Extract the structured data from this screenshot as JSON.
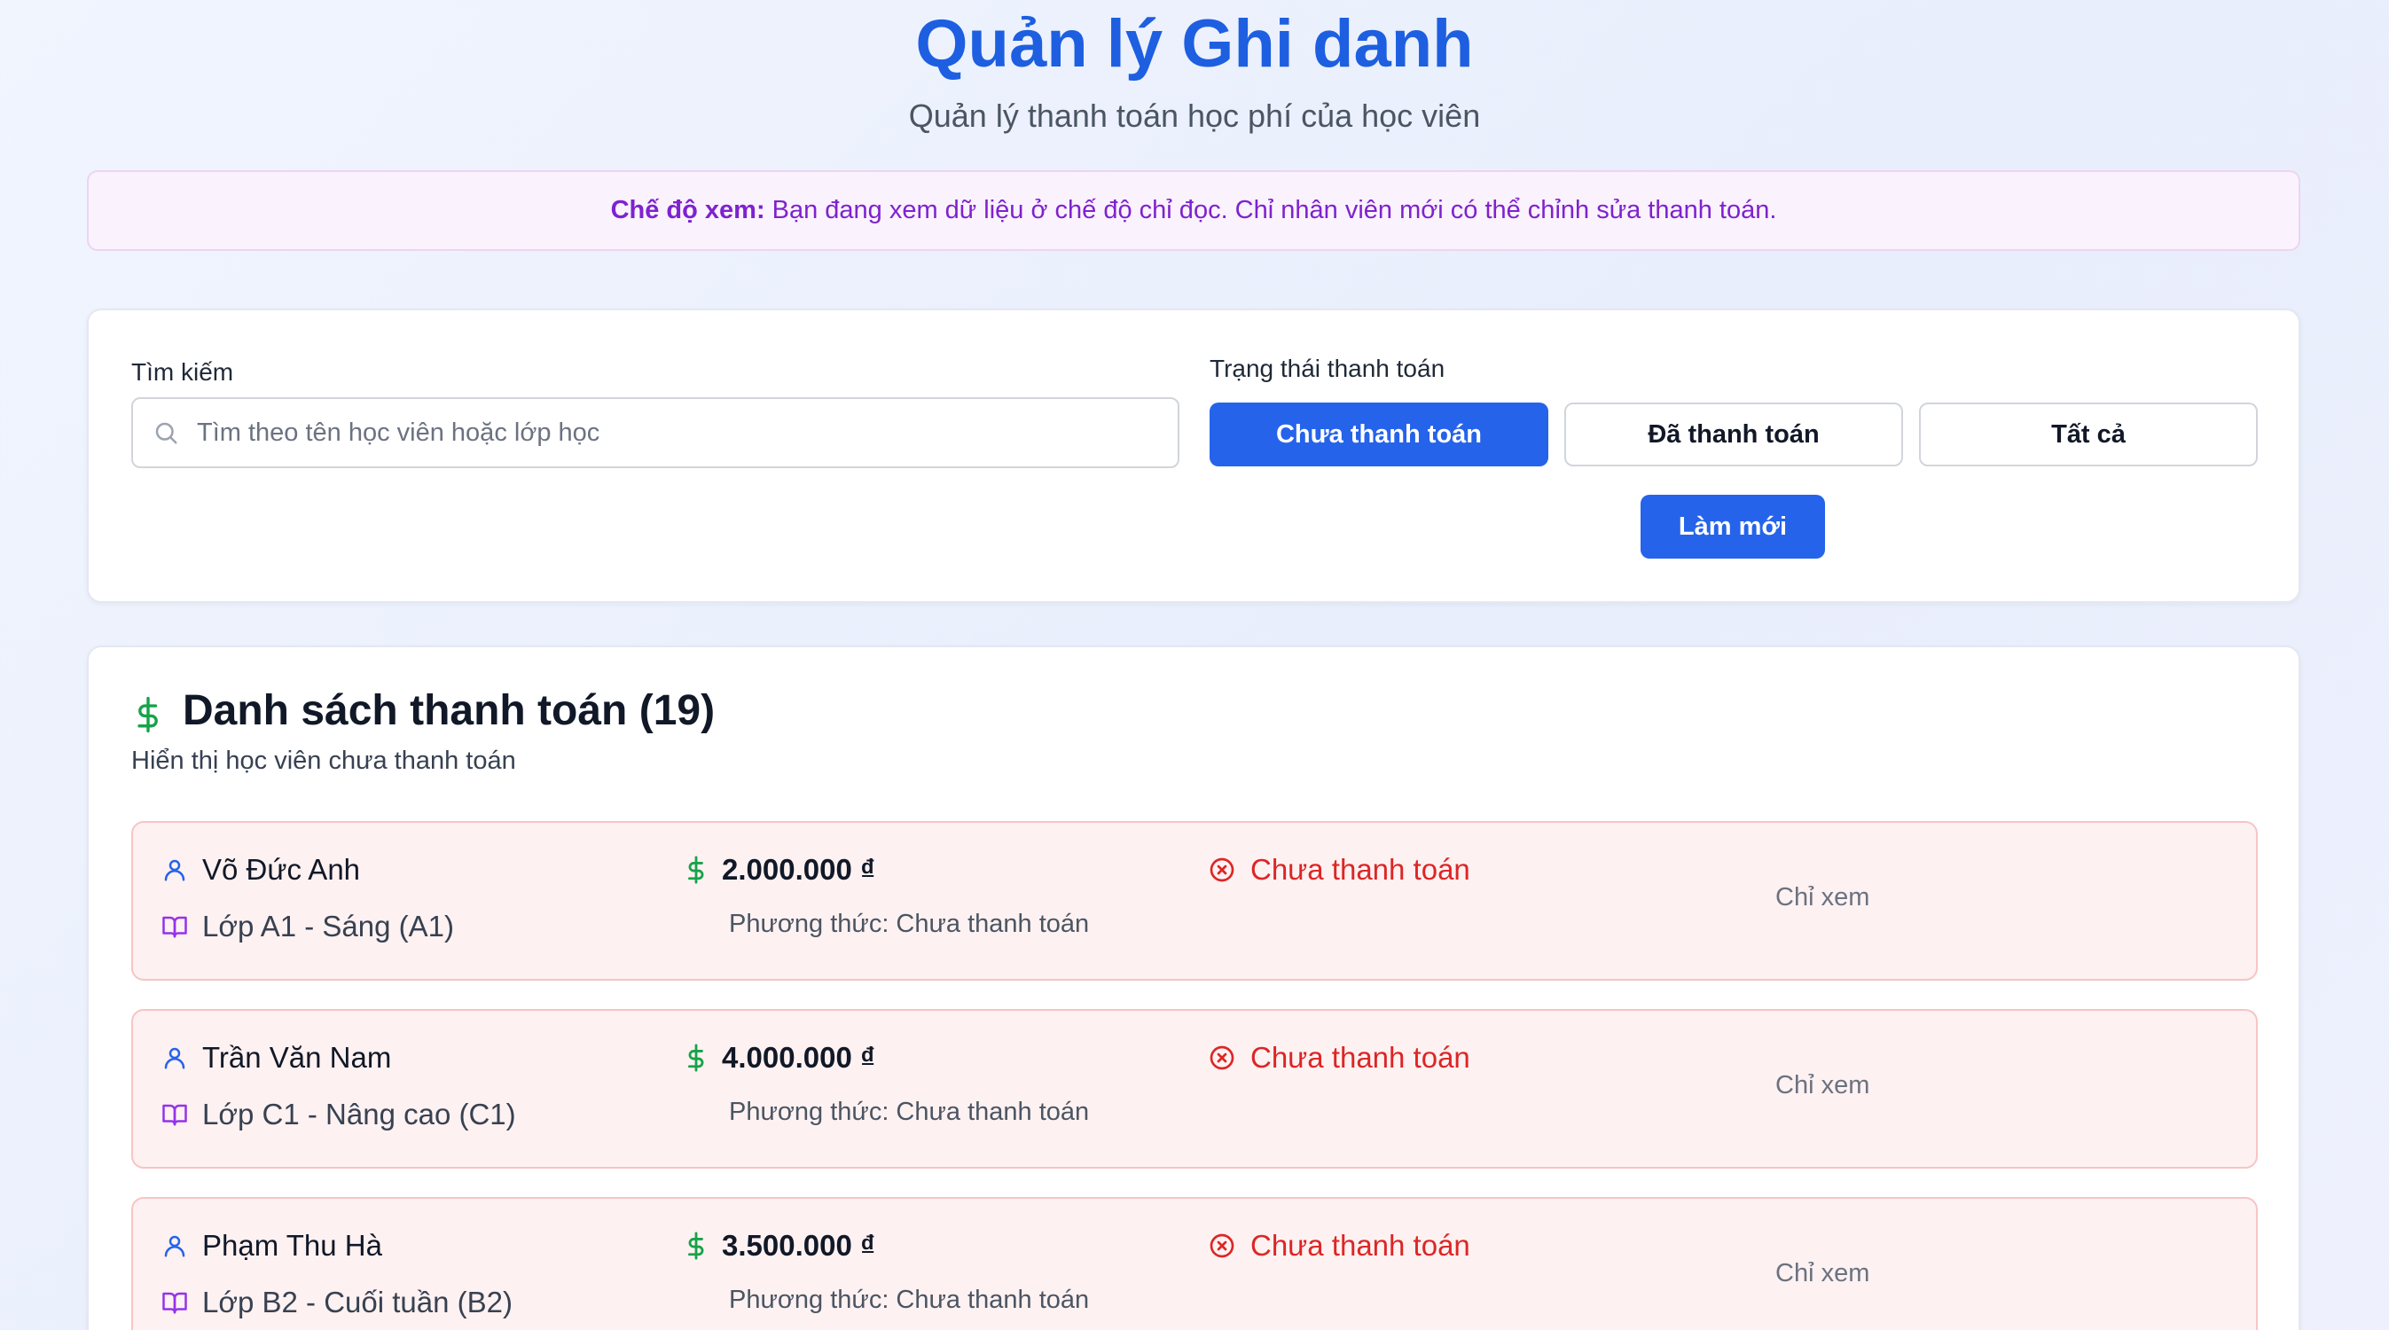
{
  "header": {
    "title": "Quản lý Ghi danh",
    "subtitle": "Quản lý thanh toán học phí của học viên"
  },
  "notice": {
    "label": "Chế độ xem:",
    "text": "Bạn đang xem dữ liệu ở chế độ chỉ đọc. Chỉ nhân viên mới có thể chỉnh sửa thanh toán."
  },
  "filters": {
    "search_label": "Tìm kiếm",
    "search_placeholder": "Tìm theo tên học viên hoặc lớp học",
    "search_value": "",
    "status_label": "Trạng thái thanh toán",
    "status_options": [
      "Chưa thanh toán",
      "Đã thanh toán",
      "Tất cả"
    ],
    "status_selected": "Chưa thanh toán",
    "refresh_label": "Làm mới"
  },
  "list": {
    "title": "Danh sách thanh toán (19)",
    "subtitle": "Hiển thị học viên chưa thanh toán",
    "rows": [
      {
        "student": "Võ Đức Anh",
        "class": "Lớp A1 - Sáng (A1)",
        "amount": "2.000.000 ₫",
        "method": "Phương thức: Chưa thanh toán",
        "status": "Chưa thanh toán",
        "action": "Chỉ xem"
      },
      {
        "student": "Trần Văn Nam",
        "class": "Lớp C1 - Nâng cao (C1)",
        "amount": "4.000.000 ₫",
        "method": "Phương thức: Chưa thanh toán",
        "status": "Chưa thanh toán",
        "action": "Chỉ xem"
      },
      {
        "student": "Phạm Thu Hà",
        "class": "Lớp B2 - Cuối tuần (B2)",
        "amount": "3.500.000 ₫",
        "method": "Phương thức: Chưa thanh toán",
        "status": "Chưa thanh toán",
        "action": "Chỉ xem"
      }
    ]
  },
  "icons": {
    "search": "search-icon",
    "dollar": "dollar-icon",
    "user": "user-icon",
    "book": "book-open-icon",
    "status": "x-circle-icon"
  },
  "colors": {
    "primary": "#2563eb",
    "title": "#1d5fe0",
    "money": "#16a34a",
    "unpaid": "#dc2626",
    "notice": "#7e22ce",
    "user_icon": "#2563eb",
    "book_icon": "#9333ea"
  }
}
